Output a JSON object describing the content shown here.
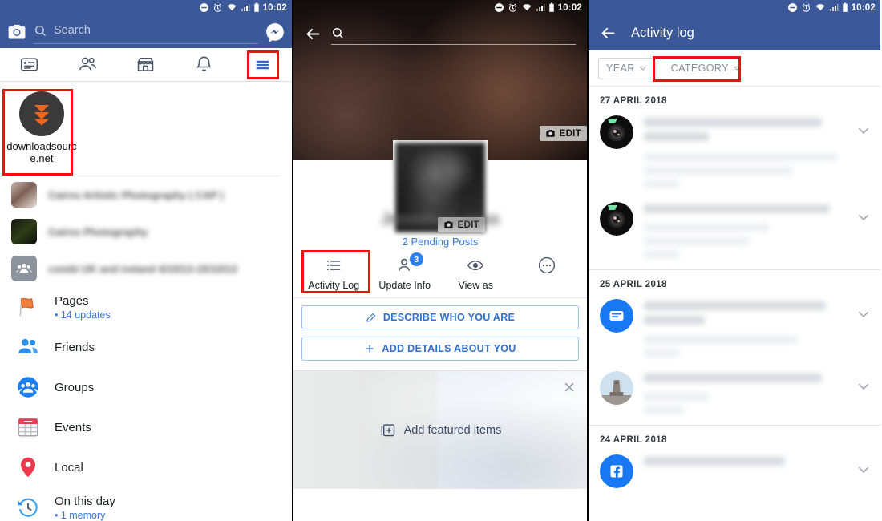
{
  "status_bar": {
    "time": "10:02",
    "icons": [
      "dnd-icon",
      "alarm-icon",
      "wifi-icon",
      "signal-icon",
      "battery-icon"
    ]
  },
  "colors": {
    "fb_blue": "#3b5998",
    "link_blue": "#3578e5",
    "highlight_red": "#ee1111",
    "badge_blue": "#2f80ed"
  },
  "panel_menu": {
    "search": {
      "placeholder": "Search",
      "camera_icon": "camera-icon",
      "messenger_icon": "messenger-icon"
    },
    "tabs": [
      {
        "name": "news-feed",
        "icon": "news-feed-icon"
      },
      {
        "name": "friends",
        "icon": "friends-icon"
      },
      {
        "name": "marketplace",
        "icon": "marketplace-icon"
      },
      {
        "name": "notifications",
        "icon": "bell-icon"
      },
      {
        "name": "menu",
        "icon": "hamburger-menu-icon",
        "highlighted": true
      }
    ],
    "profile_shortcut": {
      "name": "downloadsource.net",
      "avatar_icon": "double-chevron-down-logo"
    },
    "shortcuts": [
      {
        "label": "Cairns Artistic Photography ( CAP )",
        "blurred": true
      },
      {
        "label": "Cairns Photography",
        "blurred": true
      },
      {
        "label": "combi UK and ireland  4/10/13-15/10/13",
        "blurred": true
      }
    ],
    "items": [
      {
        "label": "Pages",
        "sub": "• 14 updates",
        "icon": "flag-icon"
      },
      {
        "label": "Friends",
        "sub": "",
        "icon": "friends-filled-icon"
      },
      {
        "label": "Groups",
        "sub": "",
        "icon": "groups-icon"
      },
      {
        "label": "Events",
        "sub": "",
        "icon": "calendar-icon"
      },
      {
        "label": "Local",
        "sub": "",
        "icon": "location-pin-icon"
      },
      {
        "label": "On this day",
        "sub": "• 1 memory",
        "icon": "clock-history-icon"
      }
    ]
  },
  "panel_profile": {
    "back_icon": "back-arrow-icon",
    "search_icon": "search-icon",
    "cover_edit": {
      "label": "EDIT",
      "icon": "camera-icon"
    },
    "photo_edit": {
      "label": "EDIT",
      "icon": "camera-icon"
    },
    "name": "Jennifer Lucas",
    "pending_posts": "2 Pending Posts",
    "actions": [
      {
        "label": "Activity Log",
        "icon": "list-icon",
        "badge": "",
        "highlighted": true
      },
      {
        "label": "Update Info",
        "icon": "person-icon",
        "badge": "3",
        "highlighted": false
      },
      {
        "label": "View as",
        "icon": "eye-icon",
        "badge": "",
        "highlighted": false
      },
      {
        "label": "",
        "icon": "more-dots-icon",
        "badge": "",
        "highlighted": false
      }
    ],
    "cta_buttons": [
      {
        "label": "DESCRIBE WHO YOU ARE",
        "icon": "pencil-icon"
      },
      {
        "label": "ADD DETAILS ABOUT YOU",
        "icon": "plus-icon"
      }
    ],
    "featured": {
      "label": "Add featured items",
      "icon": "add-featured-icon",
      "close_icon": "close-icon"
    }
  },
  "panel_activity_log": {
    "back_icon": "back-arrow-icon",
    "title": "Activity log",
    "filters": [
      {
        "label": "YEAR",
        "icon": "chevron-down-icon",
        "highlighted": false
      },
      {
        "label": "CATEGORY",
        "icon": "chevron-down-icon",
        "highlighted": true
      }
    ],
    "sections": [
      {
        "date": "27 APRIL 2018",
        "entries": [
          {
            "avatar": "camera-lens-avatar",
            "lines": 4,
            "chevron": "chevron-down-icon"
          },
          {
            "avatar": "camera-lens-avatar",
            "lines": 4,
            "chevron": "chevron-down-icon"
          }
        ]
      },
      {
        "date": "25 APRIL 2018",
        "entries": [
          {
            "avatar": "blue-post-icon",
            "lines": 4,
            "chevron": "chevron-down-icon"
          },
          {
            "avatar": "monument-photo-avatar",
            "lines": 3,
            "chevron": "chevron-down-icon"
          }
        ]
      },
      {
        "date": "24 APRIL 2018",
        "entries": [
          {
            "avatar": "facebook-f-icon",
            "lines": 1,
            "chevron": "chevron-down-icon"
          }
        ]
      }
    ]
  }
}
